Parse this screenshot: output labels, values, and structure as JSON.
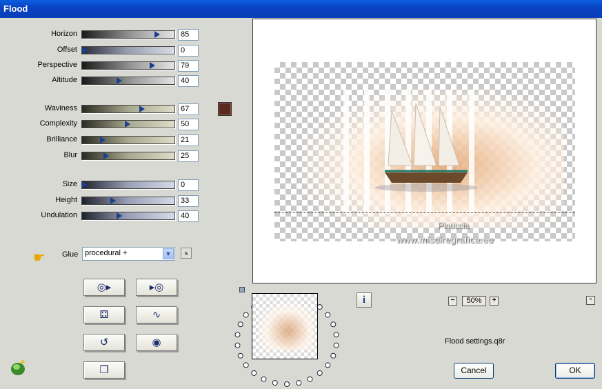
{
  "window": {
    "title": "Flood"
  },
  "sliders": [
    {
      "label": "Horizon",
      "value": "85",
      "level": 85
    },
    {
      "label": "Offset",
      "value": "0",
      "level": 0
    },
    {
      "label": "Perspective",
      "value": "79",
      "level": 79
    },
    {
      "label": "Altitude",
      "value": "40",
      "level": 40
    },
    {
      "label": "Waviness",
      "value": "67",
      "level": 67
    },
    {
      "label": "Complexity",
      "value": "50",
      "level": 50
    },
    {
      "label": "Brilliance",
      "value": "21",
      "level": 21
    },
    {
      "label": "Blur",
      "value": "25",
      "level": 25
    },
    {
      "label": "Size",
      "value": "0",
      "level": 0
    },
    {
      "label": "Height",
      "value": "33",
      "level": 33
    },
    {
      "label": "Undulation",
      "value": "40",
      "level": 40
    }
  ],
  "color_swatch": {
    "color": "#5a2a1e"
  },
  "glue": {
    "label": "Glue",
    "selected": "procedural +",
    "s_button": "s"
  },
  "tool_buttons": [
    {
      "name": "random-all-icon",
      "glyph": "◎▸"
    },
    {
      "name": "play-forward-icon",
      "glyph": "▸◎"
    },
    {
      "name": "dice-icon",
      "glyph": "⚃"
    },
    {
      "name": "wave-icon",
      "glyph": "∿"
    },
    {
      "name": "undo-icon",
      "glyph": "↺"
    },
    {
      "name": "reset-icon",
      "glyph": "◉"
    },
    {
      "name": "copy-icon",
      "glyph": "❐"
    }
  ],
  "preview": {
    "watermark_line1": "Pinuccia",
    "watermark_line2": "www.misdiregrafica.eu"
  },
  "info_button": "i",
  "zoom": {
    "minus": "−",
    "value": "50%",
    "plus": "+",
    "collapse": "^"
  },
  "settings_file": "Flood settings.q8r",
  "buttons": {
    "cancel": "Cancel",
    "ok": "OK"
  }
}
